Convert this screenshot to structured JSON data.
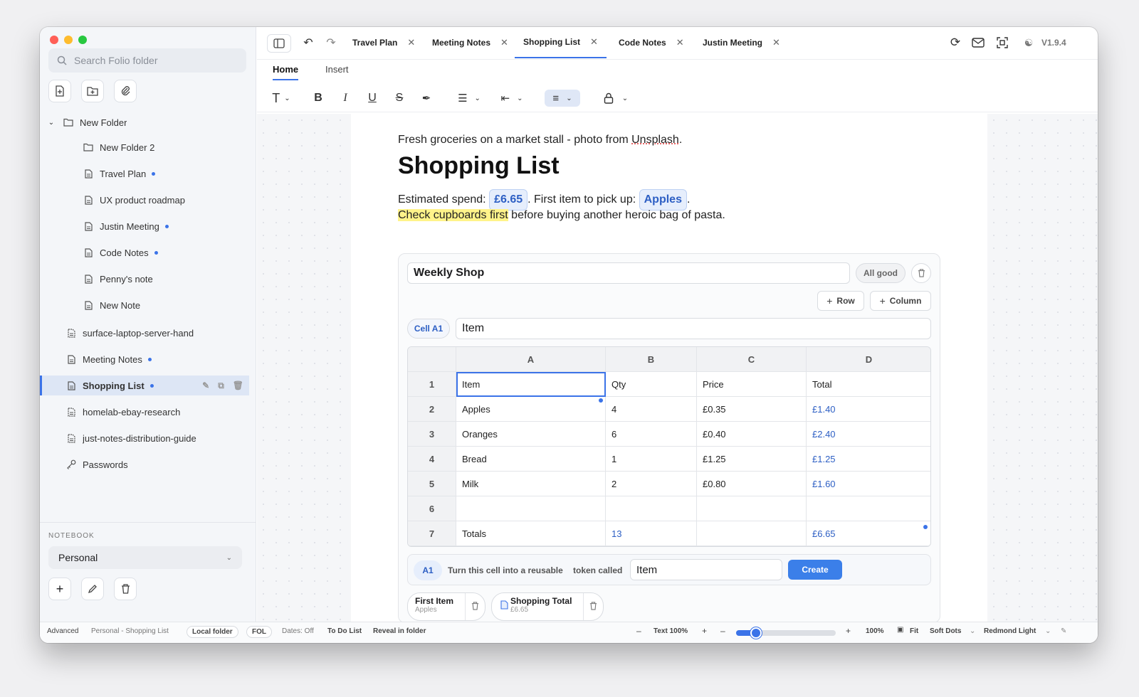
{
  "sidebar": {
    "search_placeholder": "Search Folio folder",
    "tree": [
      {
        "label": "New Folder",
        "dot": false
      },
      {
        "label": "New Folder 2",
        "dot": false
      },
      {
        "label": "Travel Plan",
        "dot": true
      },
      {
        "label": "UX product roadmap",
        "dot": false
      },
      {
        "label": "Justin Meeting",
        "dot": true
      },
      {
        "label": "Code Notes",
        "dot": true
      },
      {
        "label": "Penny's note",
        "dot": false
      },
      {
        "label": "New Note",
        "dot": false
      },
      {
        "label": "surface-laptop-server-hand",
        "dot": false
      },
      {
        "label": "Meeting Notes",
        "dot": true
      },
      {
        "label": "Shopping List",
        "dot": true
      },
      {
        "label": "homelab-ebay-research",
        "dot": false
      },
      {
        "label": "just-notes-distribution-guide",
        "dot": false
      },
      {
        "label": "Passwords",
        "dot": false
      }
    ],
    "notebook_label": "NOTEBOOK",
    "notebook_value": "Personal"
  },
  "tabs": [
    {
      "label": "Travel Plan"
    },
    {
      "label": "Meeting Notes"
    },
    {
      "label": "Shopping List"
    },
    {
      "label": "Code Notes"
    },
    {
      "label": "Justin Meeting"
    }
  ],
  "version": "V1.9.4",
  "ribbon": {
    "home": "Home",
    "insert": "Insert"
  },
  "doc": {
    "caption_pre": "Fresh groceries on a market stall - photo from ",
    "caption_link": "Unsplash",
    "caption_post": ".",
    "title": "Shopping List",
    "spend_label": "Estimated spend:",
    "spend_value": "£6.65",
    "first_label": ". First item to pick up:",
    "first_value": "Apples",
    "first_post": ".",
    "highlight": "Check cupboards first",
    "rest": " before buying another heroic bag of pasta."
  },
  "sheet": {
    "name": "Weekly Shop",
    "status": "All good",
    "add_row": "Row",
    "add_column": "Column",
    "cell_ref": "Cell A1",
    "cell_value": "Item",
    "columns": [
      "A",
      "B",
      "C",
      "D"
    ],
    "rows": [
      {
        "n": "1",
        "cells": [
          "Item",
          "Qty",
          "Price",
          "Total"
        ]
      },
      {
        "n": "2",
        "cells": [
          "Apples",
          "4",
          "£0.35",
          "£1.40"
        ]
      },
      {
        "n": "3",
        "cells": [
          "Oranges",
          "6",
          "£0.40",
          "£2.40"
        ]
      },
      {
        "n": "4",
        "cells": [
          "Bread",
          "1",
          "£1.25",
          "£1.25"
        ]
      },
      {
        "n": "5",
        "cells": [
          "Milk",
          "2",
          "£0.80",
          "£1.60"
        ]
      },
      {
        "n": "6",
        "cells": [
          "",
          "",
          "",
          ""
        ]
      },
      {
        "n": "7",
        "cells": [
          "Totals",
          "13",
          "",
          "£6.65"
        ]
      }
    ],
    "token_ref": "A1",
    "token_text1": "Turn this cell into a reusable",
    "token_text2": "token called",
    "token_value": "Item",
    "create": "Create",
    "tokens": [
      {
        "name": "First Item",
        "value": "Apples"
      },
      {
        "name": "Shopping Total",
        "value": "£6.65"
      }
    ]
  },
  "status": {
    "advanced": "Advanced",
    "path": "Personal - Shopping List",
    "local": "Local folder",
    "fol": "FOL",
    "dates": "Dates: Off",
    "todo": "To Do List",
    "reveal": "Reveal in folder",
    "text_zoom": "Text 100%",
    "zoom": "100%",
    "zoom_fraction": 0.2,
    "fit": "Fit",
    "dots": "Soft Dots",
    "theme": "Redmond Light"
  },
  "colors": {
    "accent": "#3b73e8",
    "highlight": "#fff38a"
  }
}
